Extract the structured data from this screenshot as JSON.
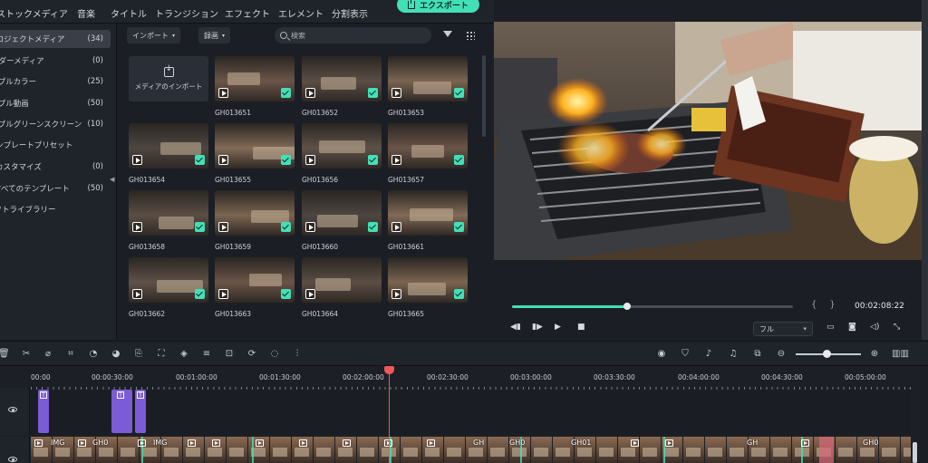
{
  "topbar": {
    "tabs": [
      "ストックメディア",
      "音楽",
      "タイトル",
      "トランジション",
      "エフェクト",
      "エレメント",
      "分割表示"
    ],
    "export_label": "エクスポート"
  },
  "sidebar": {
    "items": [
      {
        "label": "プロジェクトメディア",
        "count": "(34)"
      },
      {
        "label": "フォルダーメディア",
        "count": "(0)"
      },
      {
        "label": "サンプルカラー",
        "count": "(25)"
      },
      {
        "label": "サンプル動画",
        "count": "(50)"
      },
      {
        "label": "サンプルグリーンスクリーン",
        "count": "(10)"
      },
      {
        "label": "テンプレートプリセット",
        "count": ""
      },
      {
        "label": "カスタマイズ",
        "count": "(0)"
      },
      {
        "label": "すべてのテンプレート",
        "count": "(50)"
      },
      {
        "label": "エフェクトライブラリー",
        "count": ""
      }
    ]
  },
  "media": {
    "import_dropdown": "インポート",
    "record_dropdown": "録画",
    "search_placeholder": "検索",
    "import_tile_label": "メディアのインポート",
    "clips": [
      "GH013651",
      "GH013652",
      "GH013653",
      "GH013654",
      "GH013655",
      "GH013656",
      "GH013657",
      "GH013658",
      "GH013659",
      "GH013660",
      "GH013661",
      "GH013662",
      "GH013663",
      "GH013664",
      "GH013665"
    ]
  },
  "preview": {
    "timecode": "00:02:08:22",
    "progress": 0.41,
    "quality": "フル"
  },
  "timeline": {
    "ruler_labels": [
      "00:00",
      "00:00:30:00",
      "00:01:00:00",
      "00:01:30:00",
      "00:02:00:00",
      "00:02:30:00",
      "00:03:00:00",
      "00:03:30:00",
      "00:04:00:00",
      "00:04:30:00",
      "00:05:00:00"
    ],
    "clip_labels": [
      "IMG",
      "GH0",
      "IMG",
      "GH",
      "GH0",
      "GH01",
      "GH",
      "GH0"
    ]
  },
  "colors": {
    "accent": "#43e0b8",
    "playhead": "#f0585a",
    "title_clip": "#7b5bd6"
  }
}
